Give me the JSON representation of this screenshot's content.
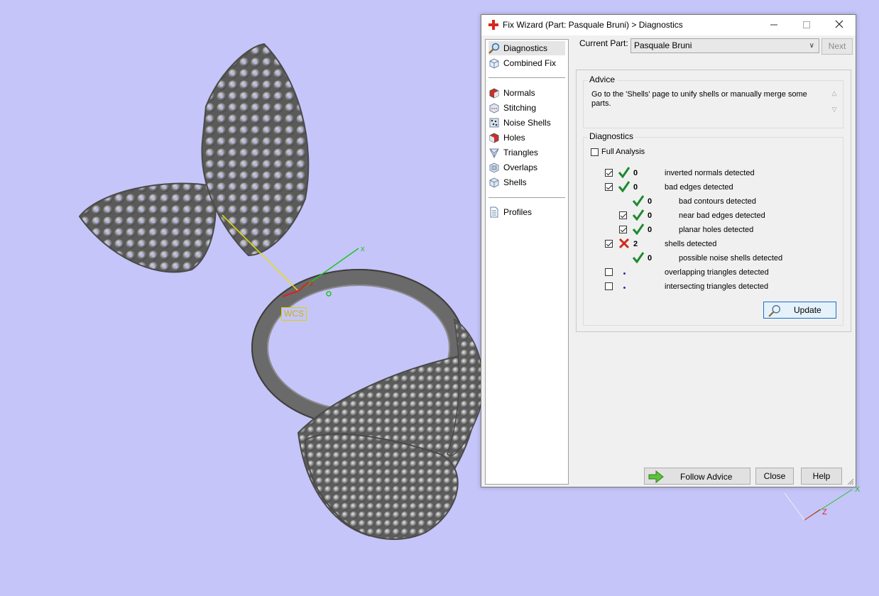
{
  "viewport": {
    "wcs_label": "WCS",
    "axis_x": "x",
    "axis_z": "z",
    "corner_axis_x": "X",
    "corner_axis_z": "Z"
  },
  "dialog": {
    "title": "Fix Wizard (Part: Pasquale Bruni) > Diagnostics",
    "nav": {
      "top": [
        {
          "label": "Diagnostics",
          "icon": "magnifier-icon"
        },
        {
          "label": "Combined Fix",
          "icon": "cube-icon"
        }
      ],
      "middle": [
        {
          "label": "Normals",
          "icon": "normals-icon"
        },
        {
          "label": "Stitching",
          "icon": "stitching-icon"
        },
        {
          "label": "Noise Shells",
          "icon": "noise-shells-icon"
        },
        {
          "label": "Holes",
          "icon": "holes-icon"
        },
        {
          "label": "Triangles",
          "icon": "triangles-icon"
        },
        {
          "label": "Overlaps",
          "icon": "overlaps-icon"
        },
        {
          "label": "Shells",
          "icon": "shells-icon"
        }
      ],
      "bottom": [
        {
          "label": "Profiles",
          "icon": "document-icon"
        }
      ]
    },
    "current_part_label": "Current Part:",
    "current_part_value": "Pasquale Bruni",
    "next_button": "Next",
    "advice": {
      "title": "Advice",
      "text": "Go to the 'Shells' page to unify shells or manually merge some parts."
    },
    "diagnostics": {
      "title": "Diagnostics",
      "full_analysis": "Full Analysis",
      "rows": [
        {
          "checkbox": true,
          "checked": true,
          "status": "ok",
          "count": "0",
          "text": "inverted normals detected",
          "indent": 0
        },
        {
          "checkbox": true,
          "checked": true,
          "status": "ok",
          "count": "0",
          "text": "bad edges detected",
          "indent": 0
        },
        {
          "checkbox": false,
          "checked": false,
          "status": "ok",
          "count": "0",
          "text": "bad contours detected",
          "indent": 1
        },
        {
          "checkbox": true,
          "checked": true,
          "status": "ok",
          "count": "0",
          "text": "near bad edges detected",
          "indent": 1
        },
        {
          "checkbox": true,
          "checked": true,
          "status": "ok",
          "count": "0",
          "text": "planar holes detected",
          "indent": 1
        },
        {
          "checkbox": true,
          "checked": true,
          "status": "error",
          "count": "2",
          "text": "shells detected",
          "indent": 0
        },
        {
          "checkbox": false,
          "checked": false,
          "status": "ok",
          "count": "0",
          "text": "possible noise shells detected",
          "indent": 1
        },
        {
          "checkbox": true,
          "checked": false,
          "status": "none",
          "count": "",
          "text": "overlapping triangles detected",
          "indent": 0
        },
        {
          "checkbox": true,
          "checked": false,
          "status": "none",
          "count": "",
          "text": "intersecting triangles detected",
          "indent": 0
        }
      ],
      "update_button": "Update"
    },
    "follow_advice_button": "Follow Advice",
    "close_button": "Close",
    "help_button": "Help"
  }
}
